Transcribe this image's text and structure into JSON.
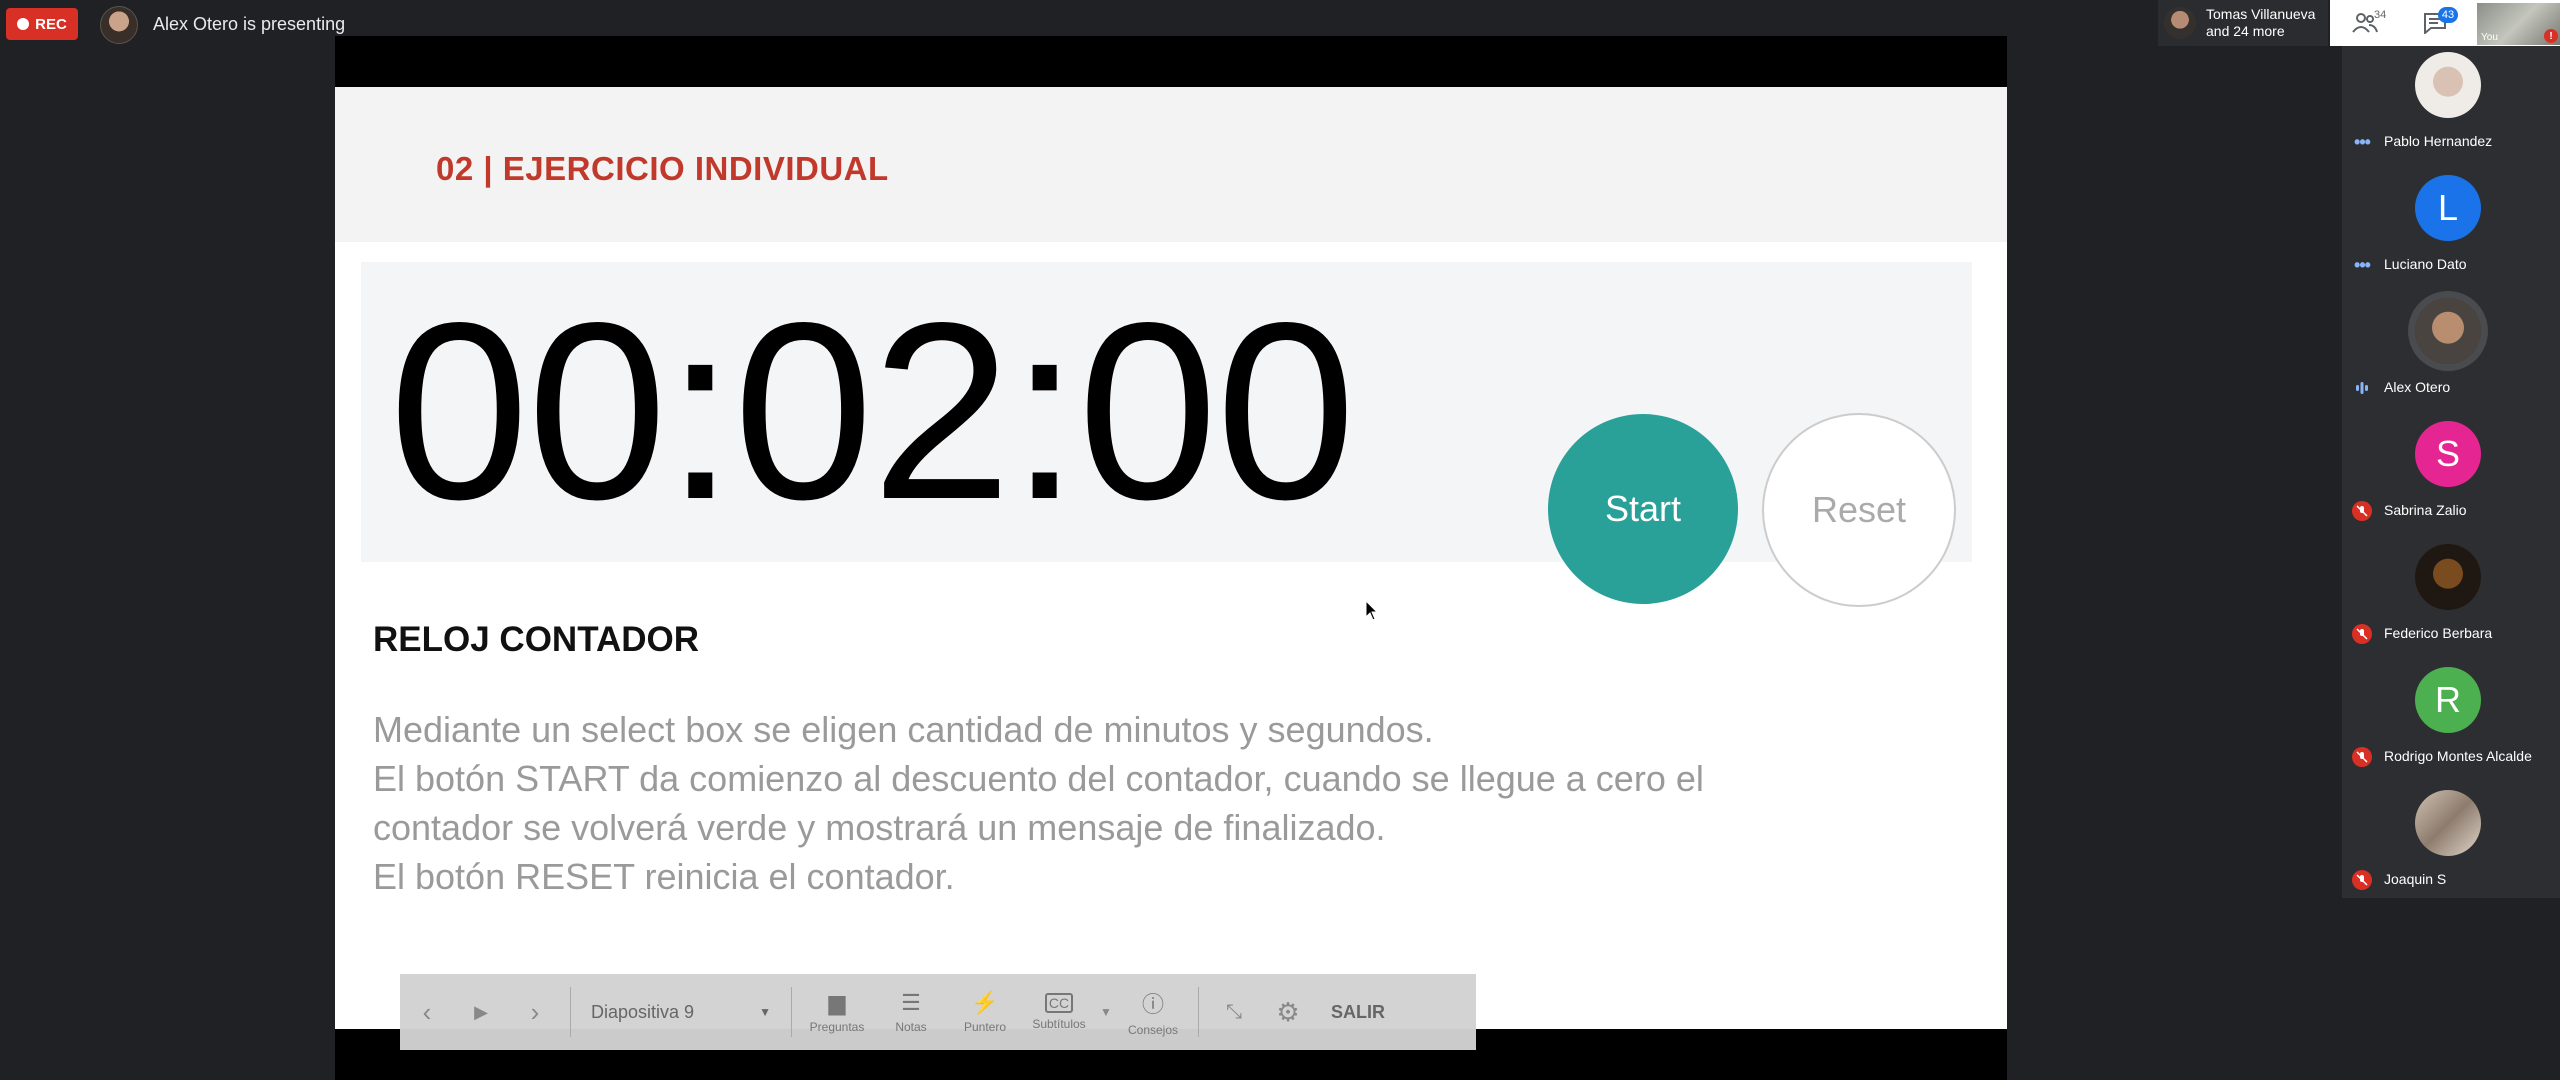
{
  "top_bar": {
    "rec_label": "REC",
    "presenter_text": "Alex Otero is presenting",
    "others_line1": "Tomas Villanueva",
    "others_line2": "and 24 more",
    "people_count": "34",
    "chat_count": "43",
    "self_label": "You",
    "alert_symbol": "!"
  },
  "slide": {
    "section_title": "02 | EJERCICIO INDIVIDUAL",
    "timer": "00:02:00",
    "start_label": "Start",
    "reset_label": "Reset",
    "body_title": "RELOJ CONTADOR",
    "body_lines": [
      "Mediante un select box se eligen cantidad de minutos y segundos.",
      "El botón START da comienzo al descuento del contador, cuando se llegue a cero el",
      "contador se volverá verde y mostrará un mensaje de finalizado.",
      "El botón RESET reinicia el contador."
    ]
  },
  "slide_controls": {
    "slide_select": "Diapositiva 9",
    "tools": [
      {
        "label": "Preguntas",
        "icon": "questions-icon"
      },
      {
        "label": "Notas",
        "icon": "notes-icon"
      },
      {
        "label": "Puntero",
        "icon": "pointer-icon"
      },
      {
        "label": "Subtítulos",
        "icon": "captions-icon"
      },
      {
        "label": "Consejos",
        "icon": "info-icon"
      }
    ],
    "exit_label": "SALIR"
  },
  "participants": [
    {
      "name": "Pablo Hernandez",
      "avatar": "photo",
      "status": "speaking-dots"
    },
    {
      "name": "Luciano Dato",
      "avatar": "L",
      "color": "#1a73e8",
      "status": "speaking-dots"
    },
    {
      "name": "Alex Otero",
      "avatar": "photo",
      "status": "audio-active"
    },
    {
      "name": "Sabrina Zalio",
      "avatar": "S",
      "color": "#e52592",
      "status": "muted"
    },
    {
      "name": "Federico Berbara",
      "avatar": "photo",
      "status": "muted"
    },
    {
      "name": "Rodrigo Montes Alcalde",
      "avatar": "R",
      "color": "#4caf50",
      "status": "muted"
    },
    {
      "name": "Joaquin S",
      "avatar": "photo",
      "status": "muted"
    }
  ],
  "colors": {
    "accent_teal": "#2aa198",
    "section_red": "#c0392b",
    "rec_red": "#d93025",
    "meet_blue": "#1a73e8"
  }
}
